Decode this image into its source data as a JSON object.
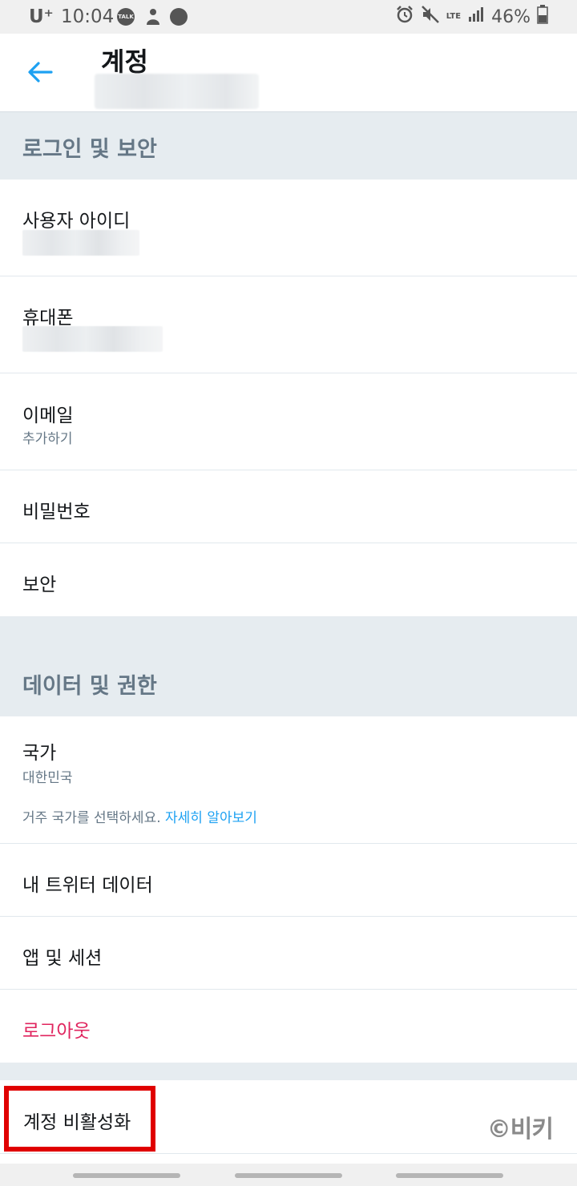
{
  "status_bar": {
    "carrier": "U⁺",
    "time": "10:04",
    "notification_icons": [
      "TALK",
      "",
      ""
    ],
    "lte": "LTE",
    "battery": "46%"
  },
  "app_bar": {
    "title": "계정"
  },
  "sections": {
    "login_security": {
      "header": "로그인 및 보안",
      "username_label": "사용자 아이디",
      "phone_label": "휴대폰",
      "email_label": "이메일",
      "email_value": "추가하기",
      "password_label": "비밀번호",
      "security_label": "보안"
    },
    "data_permissions": {
      "header": "데이터 및 권한",
      "country_label": "국가",
      "country_value": "대한민국",
      "country_hint": "거주 국가를 선택하세요.",
      "country_hint_link": "자세히 알아보기",
      "twitter_data_label": "내 트위터 데이터",
      "apps_sessions_label": "앱 및 세션",
      "logout_label": "로그아웃"
    },
    "deactivate": {
      "label": "계정 비활성화"
    }
  },
  "watermark": "©비키",
  "colors": {
    "accent": "#1da1f2",
    "section_bg": "#e6ecf0",
    "section_text": "#657786",
    "logout": "#e0245e",
    "highlight": "#e00000"
  },
  "icons": {
    "back": "arrow-left-icon"
  }
}
